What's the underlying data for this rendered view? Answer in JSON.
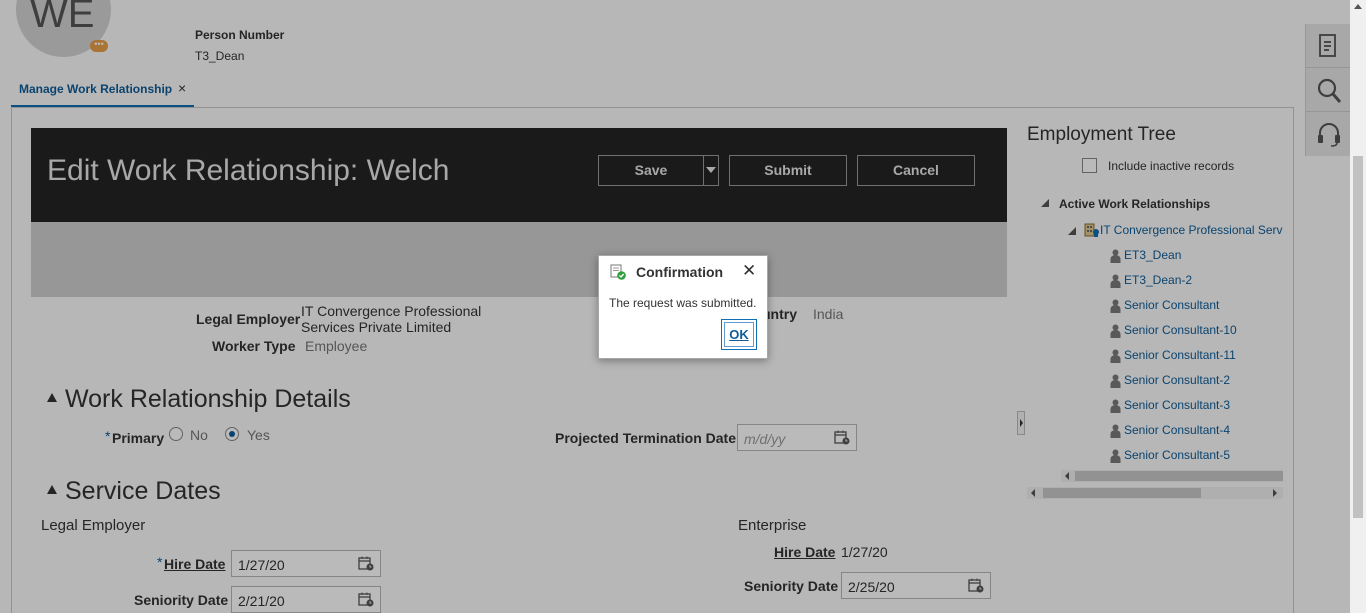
{
  "header": {
    "avatar_initials": "WE",
    "person_number_label": "Person Number",
    "person_number_value": "T3_Dean"
  },
  "tab": {
    "label": "Manage Work Relationship",
    "close": "×"
  },
  "titlebar": {
    "title": "Edit Work Relationship: Welch",
    "save_label": "Save",
    "submit_label": "Submit",
    "cancel_label": "Cancel"
  },
  "summary": {
    "legal_employer_label": "Legal Employer",
    "legal_employer_line1": "IT Convergence Professional",
    "legal_employer_line2": "Services Private Limited",
    "worker_type_label": "Worker Type",
    "worker_type_value": "Employee",
    "country_label": "untry",
    "country_value": "India"
  },
  "work_relationship_details": {
    "title": "Work Relationship Details",
    "required_mark": "*",
    "primary_label": "Primary",
    "primary_options": [
      {
        "label": "No",
        "selected": false
      },
      {
        "label": "Yes",
        "selected": true
      }
    ],
    "projected_termination_label": "Projected Termination Date",
    "projected_termination_placeholder": "m/d/yy"
  },
  "service_dates": {
    "title": "Service Dates",
    "legal_employer_heading": "Legal Employer",
    "required_mark": "*",
    "hire_date_label": "Hire Date",
    "hire_date_value": "1/27/20",
    "seniority_date_label": "Seniority Date",
    "seniority_date_value": "2/21/20",
    "enterprise_heading": "Enterprise",
    "enterprise_hire_date_label": "Hire Date",
    "enterprise_hire_date_value": "1/27/20",
    "enterprise_seniority_date_label": "Seniority Date",
    "enterprise_seniority_date_value": "2/25/20"
  },
  "employment_tree": {
    "title": "Employment Tree",
    "include_inactive_label": "Include inactive records",
    "include_inactive_checked": false,
    "root_label": "Active Work Relationships",
    "org_label": "IT Convergence Professional Serv",
    "items": [
      "ET3_Dean",
      "ET3_Dean-2",
      "Senior Consultant",
      "Senior Consultant-10",
      "Senior Consultant-11",
      "Senior Consultant-2",
      "Senior Consultant-3",
      "Senior Consultant-4",
      "Senior Consultant-5"
    ]
  },
  "dialog": {
    "title": "Confirmation",
    "message": "The request was submitted.",
    "ok_label": "OK",
    "close": "✕"
  },
  "colors": {
    "accent": "#0e5d98",
    "titlebar_bg": "#242424",
    "success_green": "#2e9e3e"
  },
  "icons": {
    "rail": [
      "document-icon",
      "search-icon",
      "headset-icon"
    ],
    "tree_person": "person-icon",
    "tree_org": "organization-icon",
    "date": "calendar-icon"
  }
}
